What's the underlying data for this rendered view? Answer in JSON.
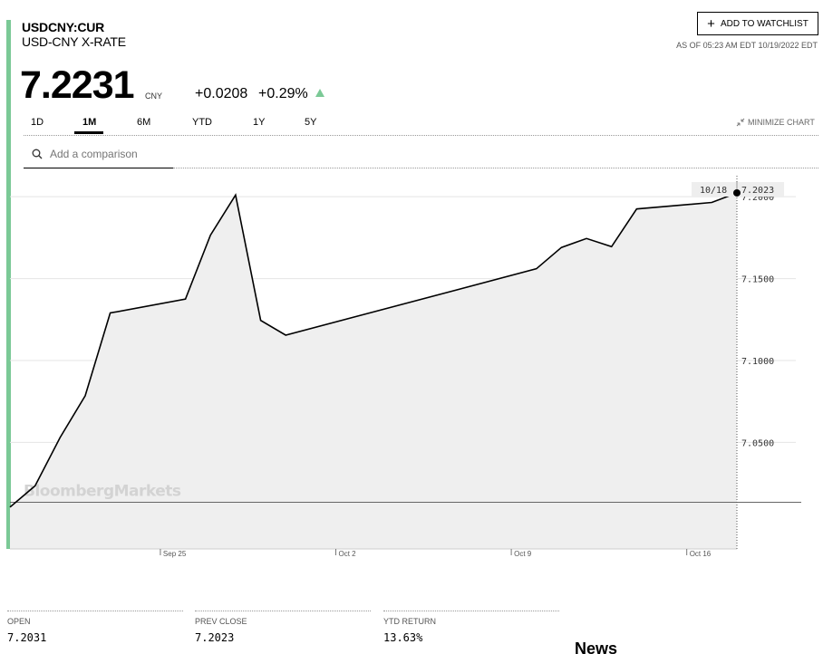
{
  "quote": {
    "ticker": "USDCNY:CUR",
    "name": "USD-CNY X-RATE",
    "price": "7.2231",
    "currency": "CNY",
    "change": "+0.0208",
    "change_pct": "+0.29%",
    "as_of": "AS OF 05:23 AM EDT 10/19/2022 EDT",
    "watchlist_label": "ADD TO WATCHLIST",
    "up_color": "#7bc996"
  },
  "range_tabs": [
    {
      "label": "1D",
      "active": false
    },
    {
      "label": "1M",
      "active": true
    },
    {
      "label": "6M",
      "active": false
    },
    {
      "label": "YTD",
      "active": false
    },
    {
      "label": "1Y",
      "active": false
    },
    {
      "label": "5Y",
      "active": false
    }
  ],
  "minimize_label": "MINIMIZE CHART",
  "search": {
    "placeholder": "Add a comparison"
  },
  "chart_data": {
    "type": "area",
    "watermark": "BloombergMarkets",
    "hover": {
      "date": "10/18",
      "value": "7.2023"
    },
    "y_ticks": [
      7.05,
      7.1,
      7.15,
      7.2
    ],
    "y_tick_labels": [
      "7.0500",
      "7.1000",
      "7.1500",
      "7.2000"
    ],
    "ylim": [
      6.985,
      7.215
    ],
    "x_ticks": [
      {
        "label": "Sep 25",
        "day": 6
      },
      {
        "label": "Oct 2",
        "day": 13
      },
      {
        "label": "Oct 9",
        "day": 20
      },
      {
        "label": "Oct 16",
        "day": 27
      }
    ],
    "reference_line": 7.0135,
    "series": [
      {
        "dates": [
          "Sep 19",
          "Sep 20",
          "Sep 21",
          "Sep 22",
          "Sep 23",
          "Sep 26",
          "Sep 27",
          "Sep 28",
          "Sep 29",
          "Sep 30",
          "Oct 10",
          "Oct 11",
          "Oct 12",
          "Oct 13",
          "Oct 14",
          "Oct 17",
          "Oct 18"
        ],
        "x_day": [
          0,
          1,
          2,
          3,
          4,
          7,
          8,
          9,
          10,
          11,
          21,
          22,
          23,
          24,
          25,
          28,
          29
        ],
        "values": [
          7.0105,
          7.0235,
          7.053,
          7.0785,
          7.129,
          7.1375,
          7.1765,
          7.201,
          7.1245,
          7.1155,
          7.156,
          7.169,
          7.1745,
          7.1695,
          7.1925,
          7.1965,
          7.2023
        ]
      }
    ]
  },
  "stats": [
    {
      "label": "OPEN",
      "value": "7.2031"
    },
    {
      "label": "PREV CLOSE",
      "value": "7.2023"
    },
    {
      "label": "YTD RETURN",
      "value": "13.63%"
    }
  ],
  "news_heading": "News"
}
